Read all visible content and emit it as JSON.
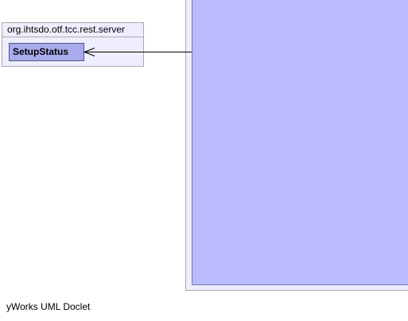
{
  "package": {
    "name": "org.ihtsdo.otf.tcc.rest.server",
    "classes": [
      {
        "name": "SetupStatus"
      }
    ]
  },
  "footer": {
    "text": "yWorks UML Doclet"
  },
  "colors": {
    "package_fill": "#eeeeff",
    "class_fill": "#aaaaee",
    "frame_fill": "#bbbbff",
    "border": "#aaaaaa"
  }
}
